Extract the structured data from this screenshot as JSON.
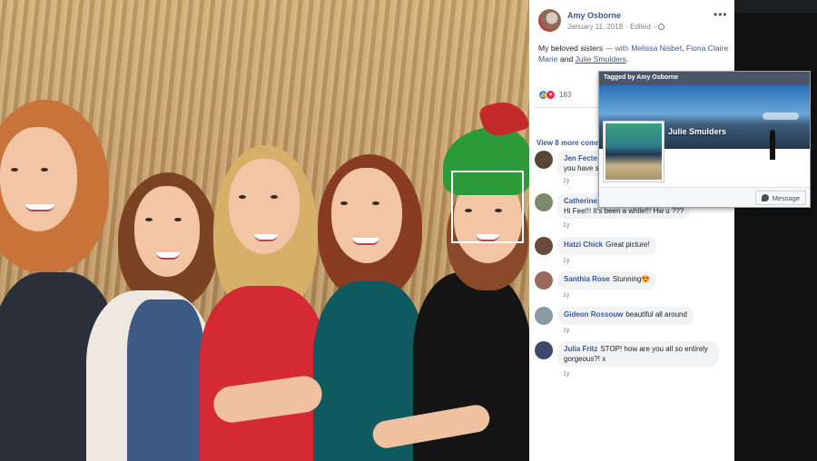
{
  "post": {
    "author": "Amy Osborne",
    "date": "January 11, 2018",
    "edited": "· Edited ·",
    "more": "•••",
    "caption_text": "My beloved sisters",
    "caption_with": " — with ",
    "tagged": [
      "Melissa Nisbet",
      "Fiona Claire Marie",
      "Julie Smulders"
    ],
    "caption_and": " and ",
    "reactions_count": "183",
    "view_more": "View 8 more comm"
  },
  "comments": [
    {
      "name": "Jen Fecte",
      "text": "you have s",
      "time": "1y"
    },
    {
      "name": "Catherine",
      "text": "Hi Fee!!! It's been a while!!! Hw u ???",
      "time": "1y"
    },
    {
      "name": "Hatzi Chick",
      "text": "Great picture!",
      "time": "1y"
    },
    {
      "name": "Santhia Rose",
      "text": "Stunning😍",
      "time": "1y"
    },
    {
      "name": "Gideon Rossouw",
      "text": "beautiful all around",
      "time": "1y"
    },
    {
      "name": "Julia Fritz",
      "text": "STOP! how are you all so entirely gorgeous?! x",
      "time": "1y"
    }
  ],
  "hovercard": {
    "header": "Tagged by Amy Osborne",
    "name": "Julie Smulders",
    "message_button": "Message"
  },
  "colors": {
    "link": "#385898",
    "like": "#2d88ff",
    "love": "#f02849"
  },
  "icons": [
    "globe-icon",
    "like-reaction-icon",
    "love-reaction-icon",
    "messenger-icon",
    "more-options-icon"
  ]
}
